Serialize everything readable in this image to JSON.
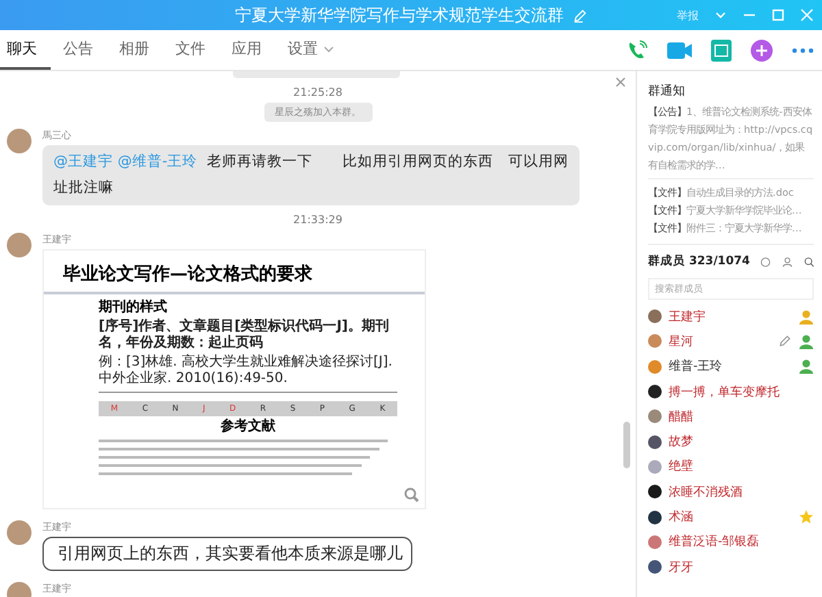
{
  "window": {
    "title": "宁夏大学新华学院写作与学术规范学生交流群",
    "report": "举报"
  },
  "tabs": [
    {
      "label": "聊天",
      "selected": true
    },
    {
      "label": "公告",
      "selected": false
    },
    {
      "label": "相册",
      "selected": false
    },
    {
      "label": "文件",
      "selected": false
    },
    {
      "label": "应用",
      "selected": false
    },
    {
      "label": "设置",
      "selected": false,
      "dropdown": true
    }
  ],
  "messages": [
    {
      "kind": "time",
      "text": "21:25:28"
    },
    {
      "kind": "notice",
      "text": "星辰之殇加入本群。"
    },
    {
      "kind": "text",
      "sender": "馬三心",
      "mentions": [
        "@王建宇",
        "@维普-王玲"
      ],
      "text": "老师再请教一下　　比如用引用网页的东西　可以用网址批注嘛"
    },
    {
      "kind": "time",
      "text": "21:33:29"
    },
    {
      "kind": "image",
      "sender": "王建宇",
      "doc": {
        "title": "毕业论文写作—论文格式的要求",
        "subtitle": "期刊的样式",
        "format": "[序号]作者、文章题目[类型标识代码一J]。期刊名，年份及期数：起止页码",
        "example": "例：[3]林雄. 高校大学生就业难解决途径探讨[J]. 中外企业家. 2010(16):49-50.",
        "codes": [
          "M",
          "C",
          "N",
          "J",
          "D",
          "R",
          "S",
          "P",
          "G",
          "K"
        ],
        "references_title": "参考文献"
      }
    },
    {
      "kind": "bubble_text",
      "sender": "王建宇",
      "text": "引用网页上的东西，其实要看他本质来源是哪儿"
    },
    {
      "kind": "sender",
      "sender": "王建宇"
    }
  ],
  "notice_panel": {
    "title": "群通知",
    "items": [
      {
        "tag": "【公告】",
        "text": "1、维普论文检测系统-西安体育学院专用版网址为：http://vpcs.cqvip.com/organ/lib/xinhua/，如果有自检需求的学…"
      },
      {
        "tag": "【文件】",
        "text": "自动生成目录的方法.doc"
      },
      {
        "tag": "【文件】",
        "text": "宁夏大学新华学院毕业论…"
      },
      {
        "tag": "【文件】",
        "text": "附件三：宁夏大学新华学…"
      }
    ]
  },
  "members": {
    "title": "群成员 323/1074",
    "search": {
      "placeholder": "搜索群成员"
    },
    "items": [
      {
        "name": "王建宇",
        "color": "#c0282d",
        "owner": true,
        "admin": false,
        "starred": false,
        "hovered": false
      },
      {
        "name": "星河",
        "color": "#c0282d",
        "owner": false,
        "admin": true,
        "starred": false,
        "hovered": true
      },
      {
        "name": "维普-王玲",
        "color": "#333333",
        "owner": false,
        "admin": true,
        "starred": false,
        "hovered": false
      },
      {
        "name": "搏一搏，单车变摩托",
        "color": "#c0282d",
        "owner": false,
        "admin": false,
        "starred": false,
        "hovered": false
      },
      {
        "name": "醋醋",
        "color": "#c0282d",
        "owner": false,
        "admin": false,
        "starred": false,
        "hovered": false
      },
      {
        "name": "故梦",
        "color": "#c0282d",
        "owner": false,
        "admin": false,
        "starred": false,
        "hovered": false
      },
      {
        "name": "绝壁",
        "color": "#c0282d",
        "owner": false,
        "admin": false,
        "starred": false,
        "hovered": false
      },
      {
        "name": "浓睡不消残酒",
        "color": "#c0282d",
        "owner": false,
        "admin": false,
        "starred": false,
        "hovered": false
      },
      {
        "name": "术涵",
        "color": "#c0282d",
        "owner": false,
        "admin": false,
        "starred": true,
        "hovered": false
      },
      {
        "name": "维普泛语-邹银磊",
        "color": "#c0282d",
        "owner": false,
        "admin": false,
        "starred": false,
        "hovered": false
      },
      {
        "name": "牙牙",
        "color": "#c0282d",
        "owner": false,
        "admin": false,
        "starred": false,
        "hovered": false
      }
    ]
  }
}
